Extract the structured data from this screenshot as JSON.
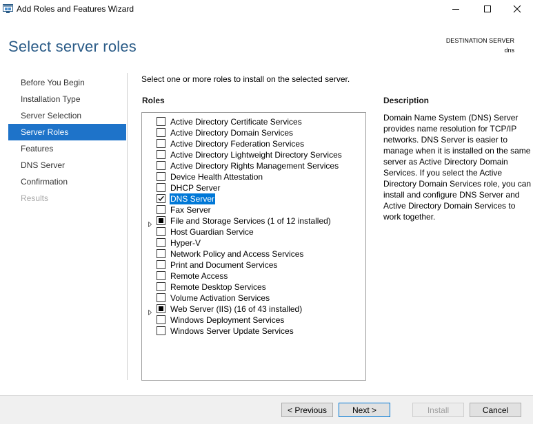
{
  "window": {
    "title": "Add Roles and Features Wizard"
  },
  "header": {
    "title": "Select server roles",
    "destination_label": "DESTINATION SERVER",
    "destination_value": "dns"
  },
  "nav": {
    "items": [
      {
        "label": "Before You Begin",
        "state": "normal"
      },
      {
        "label": "Installation Type",
        "state": "normal"
      },
      {
        "label": "Server Selection",
        "state": "normal"
      },
      {
        "label": "Server Roles",
        "state": "active"
      },
      {
        "label": "Features",
        "state": "normal"
      },
      {
        "label": "DNS Server",
        "state": "normal"
      },
      {
        "label": "Confirmation",
        "state": "normal"
      },
      {
        "label": "Results",
        "state": "disabled"
      }
    ]
  },
  "main": {
    "instruction": "Select one or more roles to install on the selected server.",
    "roles_heading": "Roles",
    "description_heading": "Description",
    "description_text": "Domain Name System (DNS) Server provides name resolution for TCP/IP networks. DNS Server is easier to manage when it is installed on the same server as Active Directory Domain Services. If you select the Active Directory Domain Services role, you can install and configure DNS Server and Active Directory Domain Services to work together.",
    "roles": [
      {
        "label": "Active Directory Certificate Services",
        "state": "unchecked",
        "expandable": false
      },
      {
        "label": "Active Directory Domain Services",
        "state": "unchecked",
        "expandable": false
      },
      {
        "label": "Active Directory Federation Services",
        "state": "unchecked",
        "expandable": false
      },
      {
        "label": "Active Directory Lightweight Directory Services",
        "state": "unchecked",
        "expandable": false
      },
      {
        "label": "Active Directory Rights Management Services",
        "state": "unchecked",
        "expandable": false
      },
      {
        "label": "Device Health Attestation",
        "state": "unchecked",
        "expandable": false
      },
      {
        "label": "DHCP Server",
        "state": "unchecked",
        "expandable": false
      },
      {
        "label": "DNS Server",
        "state": "checked",
        "expandable": false,
        "selected": true
      },
      {
        "label": "Fax Server",
        "state": "unchecked",
        "expandable": false
      },
      {
        "label": "File and Storage Services (1 of 12 installed)",
        "state": "partial",
        "expandable": true
      },
      {
        "label": "Host Guardian Service",
        "state": "unchecked",
        "expandable": false
      },
      {
        "label": "Hyper-V",
        "state": "unchecked",
        "expandable": false
      },
      {
        "label": "Network Policy and Access Services",
        "state": "unchecked",
        "expandable": false
      },
      {
        "label": "Print and Document Services",
        "state": "unchecked",
        "expandable": false
      },
      {
        "label": "Remote Access",
        "state": "unchecked",
        "expandable": false
      },
      {
        "label": "Remote Desktop Services",
        "state": "unchecked",
        "expandable": false
      },
      {
        "label": "Volume Activation Services",
        "state": "unchecked",
        "expandable": false
      },
      {
        "label": "Web Server (IIS) (16 of 43 installed)",
        "state": "partial",
        "expandable": true
      },
      {
        "label": "Windows Deployment Services",
        "state": "unchecked",
        "expandable": false
      },
      {
        "label": "Windows Server Update Services",
        "state": "unchecked",
        "expandable": false
      }
    ]
  },
  "footer": {
    "previous_label": "< Previous",
    "next_label": "Next >",
    "install_label": "Install",
    "cancel_label": "Cancel"
  },
  "colors": {
    "title_blue": "#2a5b87",
    "nav_active_bg": "#1e73c9",
    "selection_bg": "#0078d7"
  },
  "icons": {
    "app": "server-manager-icon",
    "minimize": "minimize-icon",
    "maximize": "maximize-icon",
    "close": "close-icon",
    "expander": "expand-triangle-icon",
    "check": "checkmark-icon"
  }
}
